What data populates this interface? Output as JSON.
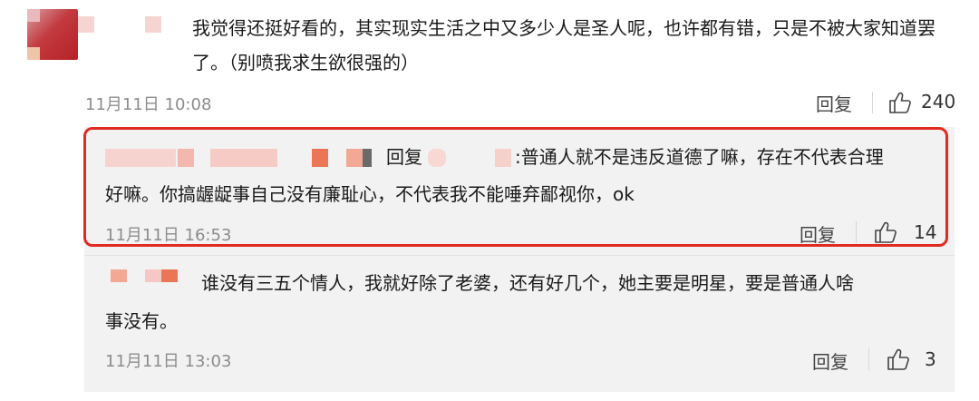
{
  "top_comment": {
    "text": "我觉得还挺好看的，其实现实生活之中又多少人是圣人呢，也许都有错，只是不被大家知道罢了。（别喷我求生欲很强的）",
    "time": "11月11日 10:08",
    "reply_label": "回复",
    "likes": "240"
  },
  "reply_1": {
    "reply_word": "回复",
    "text_line1": ":普通人就不是违反道德了嘛，存在不代表合理",
    "text_line2": "好嘛。你搞龌龊事自己没有廉耻心，不代表我不能唾弃鄙视你，ok",
    "time": "11月11日 16:53",
    "reply_label": "回复",
    "likes": "14"
  },
  "reply_2": {
    "text_line1": "谁没有三五个情人，我就好除了老婆，还有好几个，她主要是明星，要是普通人啥",
    "text_line2": "事没有。",
    "time": "11月11日 13:03",
    "reply_label": "回复",
    "likes": "3"
  },
  "colors": {
    "highlight_border": "#e12b22",
    "panel_bg": "#f2f2f2",
    "pixel_mask_light": "#f6c7c4",
    "pixel_mask_dark": "#ec7558",
    "avatar_red": "#b52126"
  },
  "icons": [
    "thumbs-up-icon"
  ]
}
